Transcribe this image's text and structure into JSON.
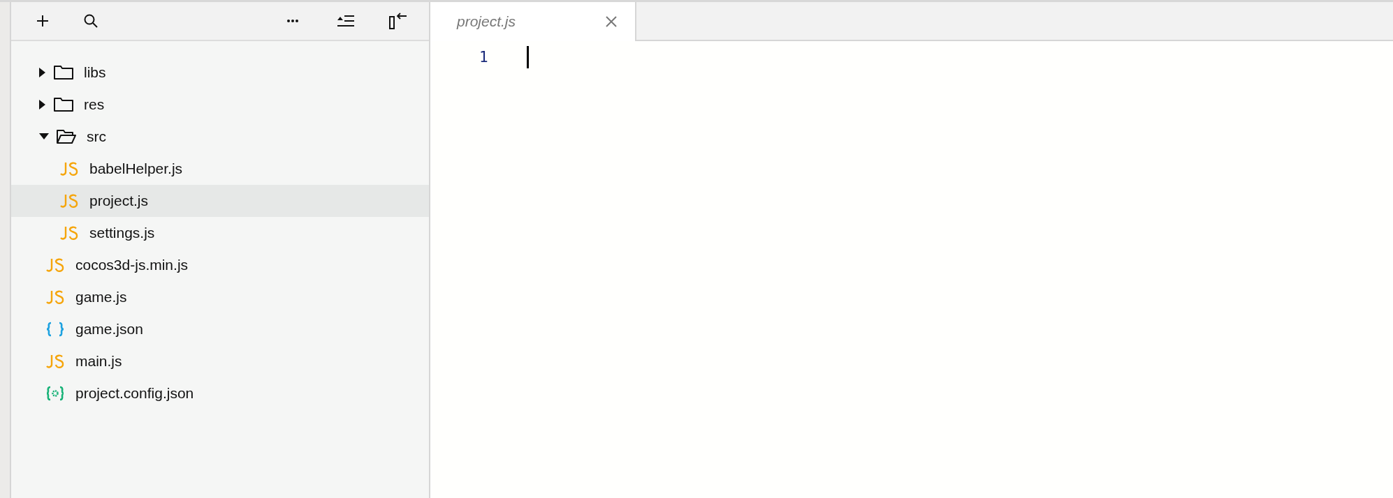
{
  "tree": [
    {
      "label": "libs",
      "kind": "folder",
      "expanded": false,
      "selected": false
    },
    {
      "label": "res",
      "kind": "folder",
      "expanded": false,
      "selected": false
    },
    {
      "label": "src",
      "kind": "folder",
      "expanded": true,
      "selected": false,
      "children": [
        {
          "label": "babelHelper.js",
          "kind": "js",
          "selected": false
        },
        {
          "label": "project.js",
          "kind": "js",
          "selected": true
        },
        {
          "label": "settings.js",
          "kind": "js",
          "selected": false
        }
      ]
    },
    {
      "label": "cocos3d-js.min.js",
      "kind": "js",
      "selected": false
    },
    {
      "label": "game.js",
      "kind": "js",
      "selected": false
    },
    {
      "label": "game.json",
      "kind": "json",
      "selected": false
    },
    {
      "label": "main.js",
      "kind": "js",
      "selected": false
    },
    {
      "label": "project.config.json",
      "kind": "config",
      "selected": false
    }
  ],
  "tabs": [
    {
      "label": "project.js",
      "selected": true
    }
  ],
  "editor": {
    "line_numbers": [
      "1"
    ]
  }
}
